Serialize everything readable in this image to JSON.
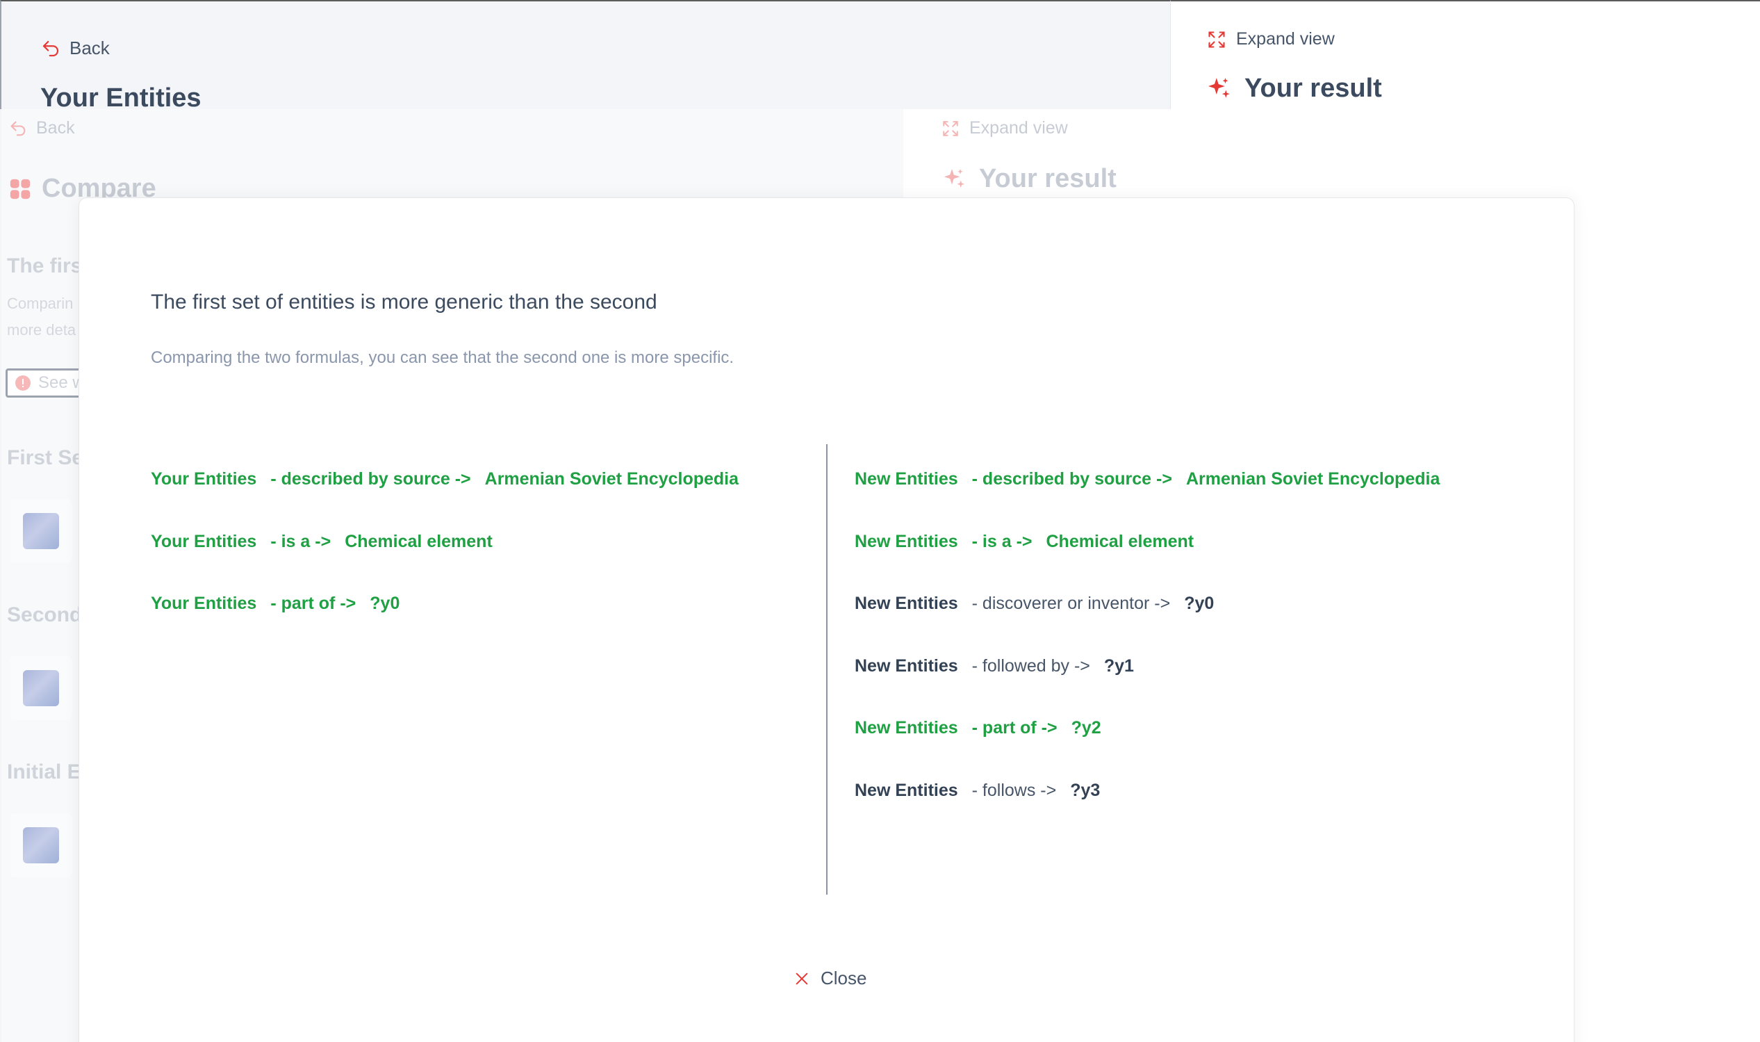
{
  "base": {
    "back_label": "Back",
    "page_title": "Your Entities",
    "expand_label": "Expand view",
    "result_title": "Your result"
  },
  "mid": {
    "back_label": "Back",
    "compare_title": "Compare",
    "expand_label": "Expand view",
    "result_title": "Your result",
    "heading_partial": "The firs",
    "desc_line1": "Comparin",
    "desc_line2": "more deta",
    "see_button_partial": "See w",
    "section_first": "First Se",
    "section_second": "Second",
    "section_initial": "Initial E"
  },
  "modal": {
    "title": "The first set of entities is more generic than the second",
    "subtitle": "Comparing the two formulas, you can see that the second one is more specific.",
    "left_rows": [
      {
        "subject": "Your Entities",
        "predicate": "- described by source ->",
        "object": "Armenian Soviet Encyclopedia",
        "match": true
      },
      {
        "subject": "Your Entities",
        "predicate": "- is a ->",
        "object": "Chemical element",
        "match": true
      },
      {
        "subject": "Your Entities",
        "predicate": "- part of ->",
        "object": "?y0",
        "match": true
      }
    ],
    "right_rows": [
      {
        "subject": "New Entities",
        "predicate": "- described by source ->",
        "object": "Armenian Soviet Encyclopedia",
        "match": true
      },
      {
        "subject": "New Entities",
        "predicate": "- is a ->",
        "object": "Chemical element",
        "match": true
      },
      {
        "subject": "New Entities",
        "predicate": "- discoverer or inventor ->",
        "object": "?y0",
        "match": false
      },
      {
        "subject": "New Entities",
        "predicate": "- followed by ->",
        "object": "?y1",
        "match": false
      },
      {
        "subject": "New Entities",
        "predicate": "- part of ->",
        "object": "?y2",
        "match": true
      },
      {
        "subject": "New Entities",
        "predicate": "- follows ->",
        "object": "?y3",
        "match": false
      }
    ],
    "close_label": "Close"
  },
  "colors": {
    "match_green": "#1ea043",
    "accent_red": "#e53935",
    "text_dark": "#334155"
  }
}
